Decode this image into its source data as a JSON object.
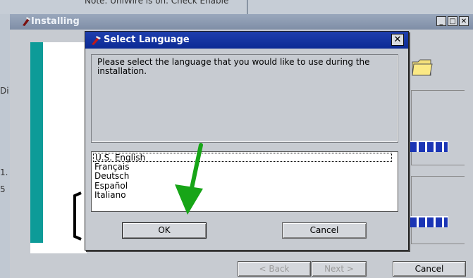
{
  "background": {
    "top_text": "Note: UniWire is on. Check Enable",
    "fragments": [
      "Di",
      "1.",
      "5"
    ]
  },
  "installer": {
    "title": "Installing",
    "buttons": {
      "back": "< Back",
      "next": "Next >",
      "cancel": "Cancel"
    }
  },
  "dialog": {
    "title": "Select Language",
    "close_glyph": "✕",
    "message": "Please select the language that you would like to use during the installation.",
    "languages": [
      "U.S. English",
      "Français",
      "Deutsch",
      "Español",
      "Italiano"
    ],
    "selected_language": "U.S. English",
    "ok_label": "OK",
    "cancel_label": "Cancel"
  },
  "colors": {
    "dialog_title_bar": "#0b2a94",
    "arrow": "#17a517",
    "teal_bar": "#0d9b98",
    "progress": "#1b35b5"
  }
}
